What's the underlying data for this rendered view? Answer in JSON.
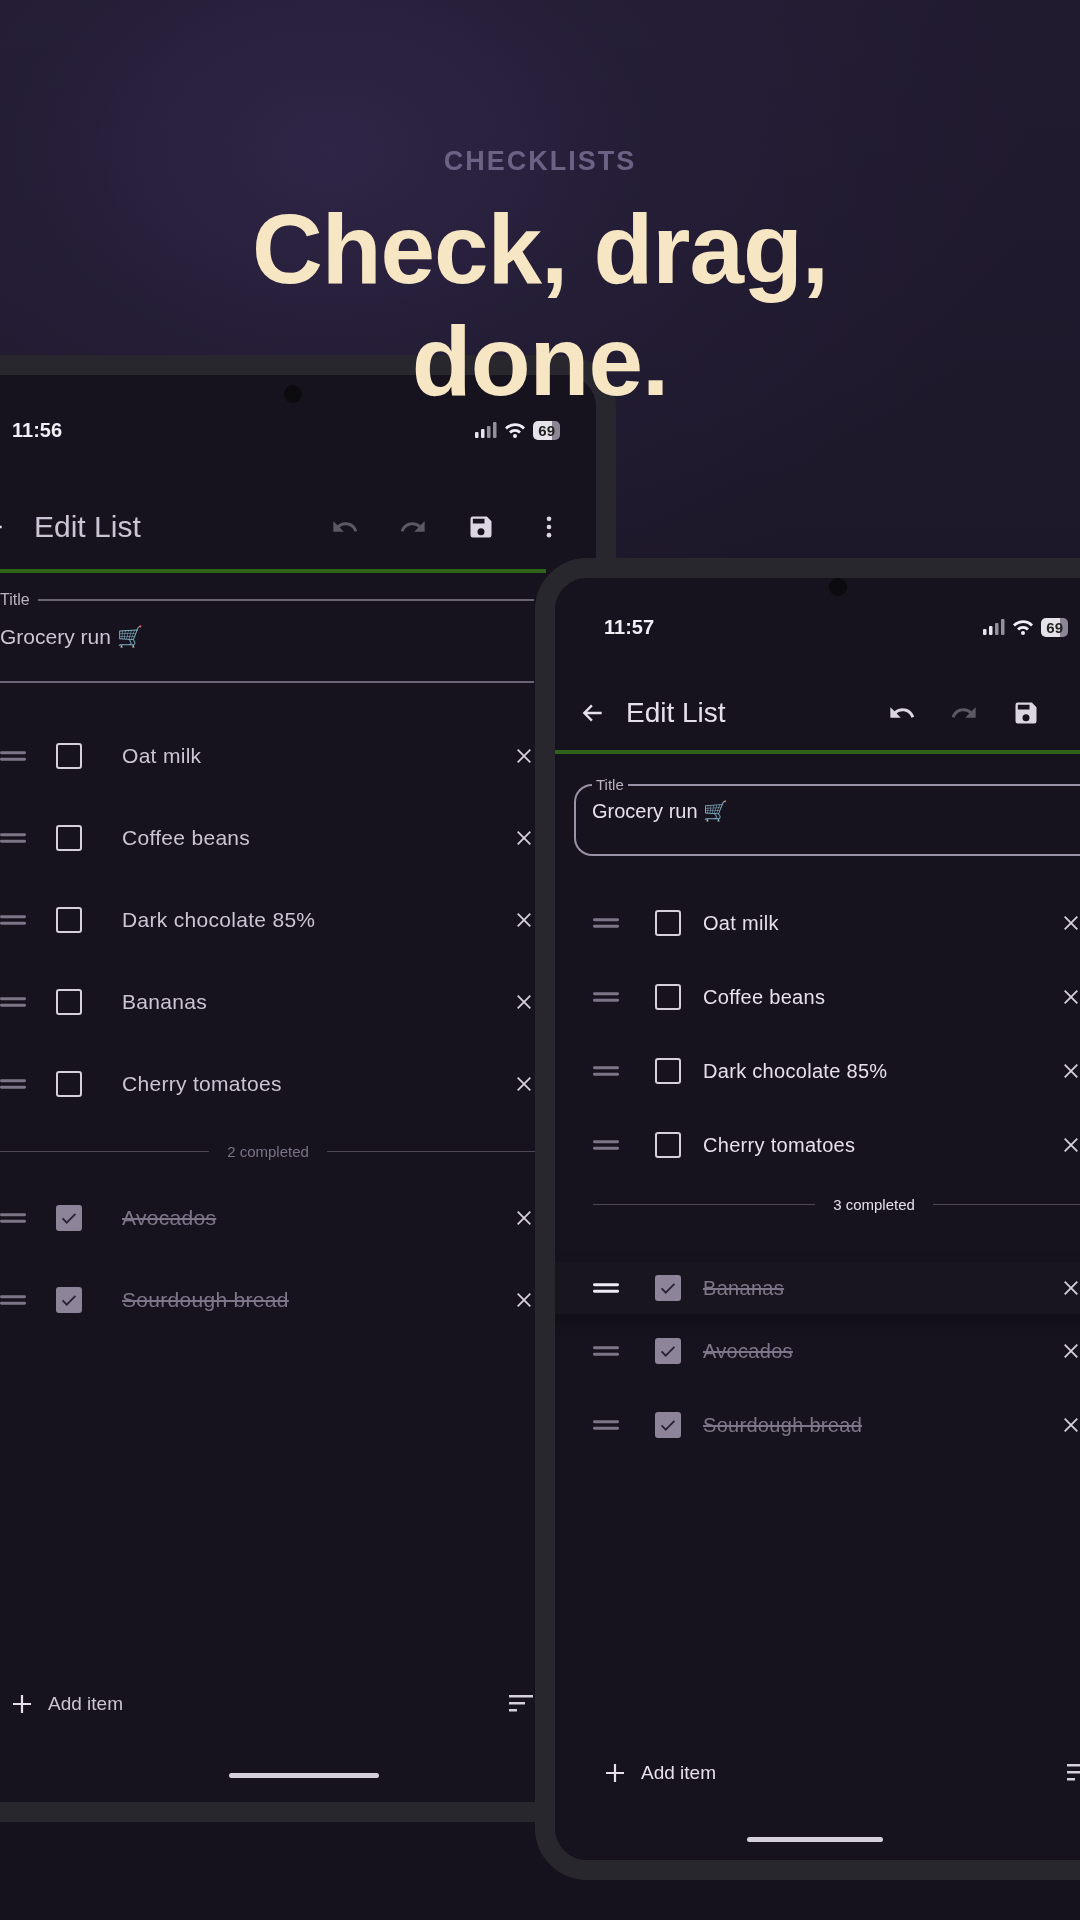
{
  "header": {
    "eyebrow": "CHECKLISTS",
    "headline": [
      "Check, drag,",
      "done."
    ]
  },
  "phones": [
    {
      "status_bar": {
        "time": "11:56",
        "battery": "69"
      },
      "app_bar": {
        "title": "Edit List",
        "actions": [
          {
            "kind": "undo",
            "enabled": false
          },
          {
            "kind": "redo",
            "enabled": false
          },
          {
            "kind": "save",
            "enabled": true
          },
          {
            "kind": "menu",
            "enabled": true
          }
        ]
      },
      "progress": {
        "level": 1
      },
      "title_field": {
        "kind": "underline",
        "label": "Title",
        "value": "Grocery run 🛒"
      },
      "items": [
        {
          "text": "Oat milk",
          "checked": false,
          "dragging": false
        },
        {
          "text": "Coffee beans",
          "checked": false,
          "dragging": false
        },
        {
          "text": "Dark chocolate 85%",
          "checked": false,
          "dragging": false
        },
        {
          "text": "Bananas",
          "checked": false,
          "dragging": false
        },
        {
          "text": "Cherry tomatoes",
          "checked": false,
          "dragging": false
        }
      ],
      "completed_label": "2 completed",
      "completed_items": [
        {
          "text": "Avocados",
          "checked": true,
          "dragging": false
        },
        {
          "text": "Sourdough bread",
          "checked": true,
          "dragging": false
        }
      ],
      "add_label": "Add item"
    },
    {
      "status_bar": {
        "time": "11:57",
        "battery": "69"
      },
      "app_bar": {
        "title": "Edit List",
        "actions": [
          {
            "kind": "undo",
            "enabled": true
          },
          {
            "kind": "redo",
            "enabled": false
          },
          {
            "kind": "save",
            "enabled": true
          }
        ]
      },
      "progress": {
        "level": 1
      },
      "title_field": {
        "kind": "outlined",
        "label": "Title",
        "value": "Grocery run 🛒"
      },
      "items": [
        {
          "text": "Oat milk",
          "checked": false,
          "dragging": false
        },
        {
          "text": "Coffee beans",
          "checked": false,
          "dragging": false
        },
        {
          "text": "Dark chocolate 85%",
          "checked": false,
          "dragging": false
        },
        {
          "text": "Cherry tomatoes",
          "checked": false,
          "dragging": false
        }
      ],
      "completed_label": "3 completed",
      "completed_items": [
        {
          "text": "Bananas",
          "checked": true,
          "dragging": true
        },
        {
          "text": "Avocados",
          "checked": true,
          "dragging": false
        },
        {
          "text": "Sourdough bread",
          "checked": true,
          "dragging": false
        }
      ],
      "add_label": "Add item"
    }
  ]
}
